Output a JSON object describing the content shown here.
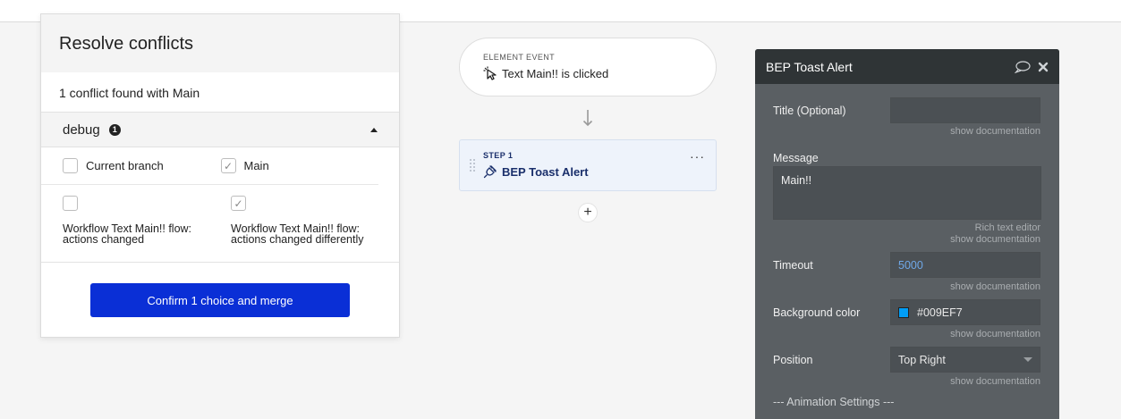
{
  "conflicts": {
    "title": "Resolve conflicts",
    "found_text": "1 conflict found with Main",
    "section_name": "debug",
    "section_count": "1",
    "col_current": "Current branch",
    "col_main": "Main",
    "current_desc": "Workflow Text Main!! flow: actions changed",
    "main_desc": "Workflow Text Main!! flow: actions changed differently",
    "confirm_label": "Confirm 1 choice and merge"
  },
  "workflow": {
    "event_label": "ELEMENT EVENT",
    "event_title": "Text Main!! is clicked",
    "step_label": "STEP 1",
    "step_title": "BEP Toast Alert",
    "more_label": "···",
    "add_label": "+"
  },
  "editor": {
    "title": "BEP Toast Alert",
    "title_field_label": "Title (Optional)",
    "title_value": "",
    "show_doc": "show documentation",
    "message_label": "Message",
    "message_value": "Main!!",
    "rich_text": "Rich text editor",
    "timeout_label": "Timeout",
    "timeout_value": "5000",
    "bg_label": "Background color",
    "bg_value": "#009EF7",
    "position_label": "Position",
    "position_value": "Top Right",
    "animation_label": "--- Animation Settings ---"
  },
  "colors": {
    "confirm_button": "#0A2FD6",
    "toast_bg": "#009EF7",
    "editor_bg": "#5A5F63",
    "timeout_text": "#6FA8E8"
  },
  "icons": {
    "event": "cursor-click-icon",
    "step": "plugin-icon",
    "comment": "comment-icon",
    "close": "close-icon"
  }
}
